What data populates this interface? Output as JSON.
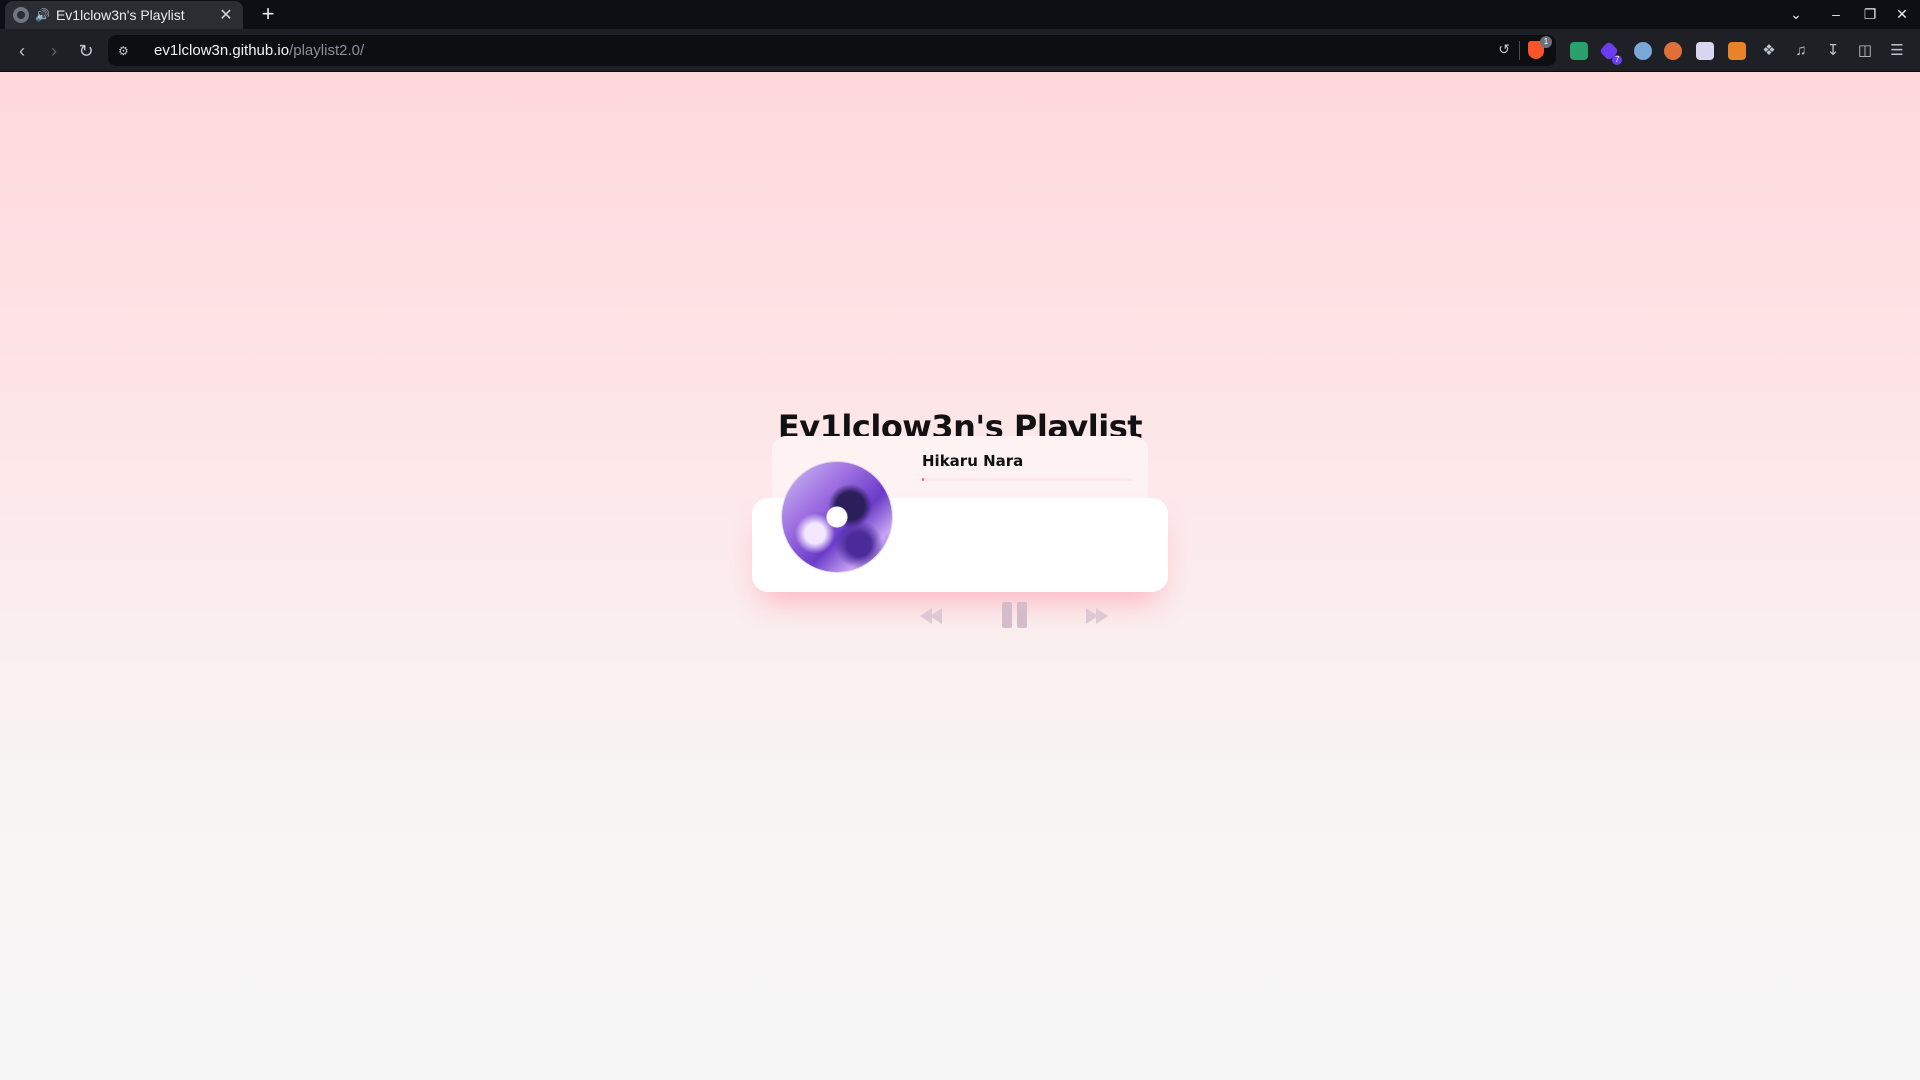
{
  "browser": {
    "tab": {
      "title": "Ev1lclow3n's Playlist",
      "audio_glyph": "🔊",
      "close_glyph": "✕"
    },
    "new_tab_glyph": "+",
    "url": {
      "host": "ev1lclow3n.github.io",
      "path": "/playlist2.0/"
    },
    "shield_badge": "1",
    "extension_badge": "7",
    "window_controls": {
      "dropdown": "⌄",
      "minimize": "–",
      "restore": "❐",
      "close": "✕"
    }
  },
  "page": {
    "title": "Ev1lclow3n's Playlist"
  },
  "player": {
    "song_title": "Hikaru Nara",
    "progress_fraction": 0.01,
    "state": "playing",
    "controls": [
      "previous",
      "pause",
      "next"
    ]
  },
  "colors": {
    "accent": "#ff5a6e",
    "page_top": "#ffd8dc",
    "page_bottom": "#f7f7f7",
    "control_icon": "#d4bccb"
  }
}
